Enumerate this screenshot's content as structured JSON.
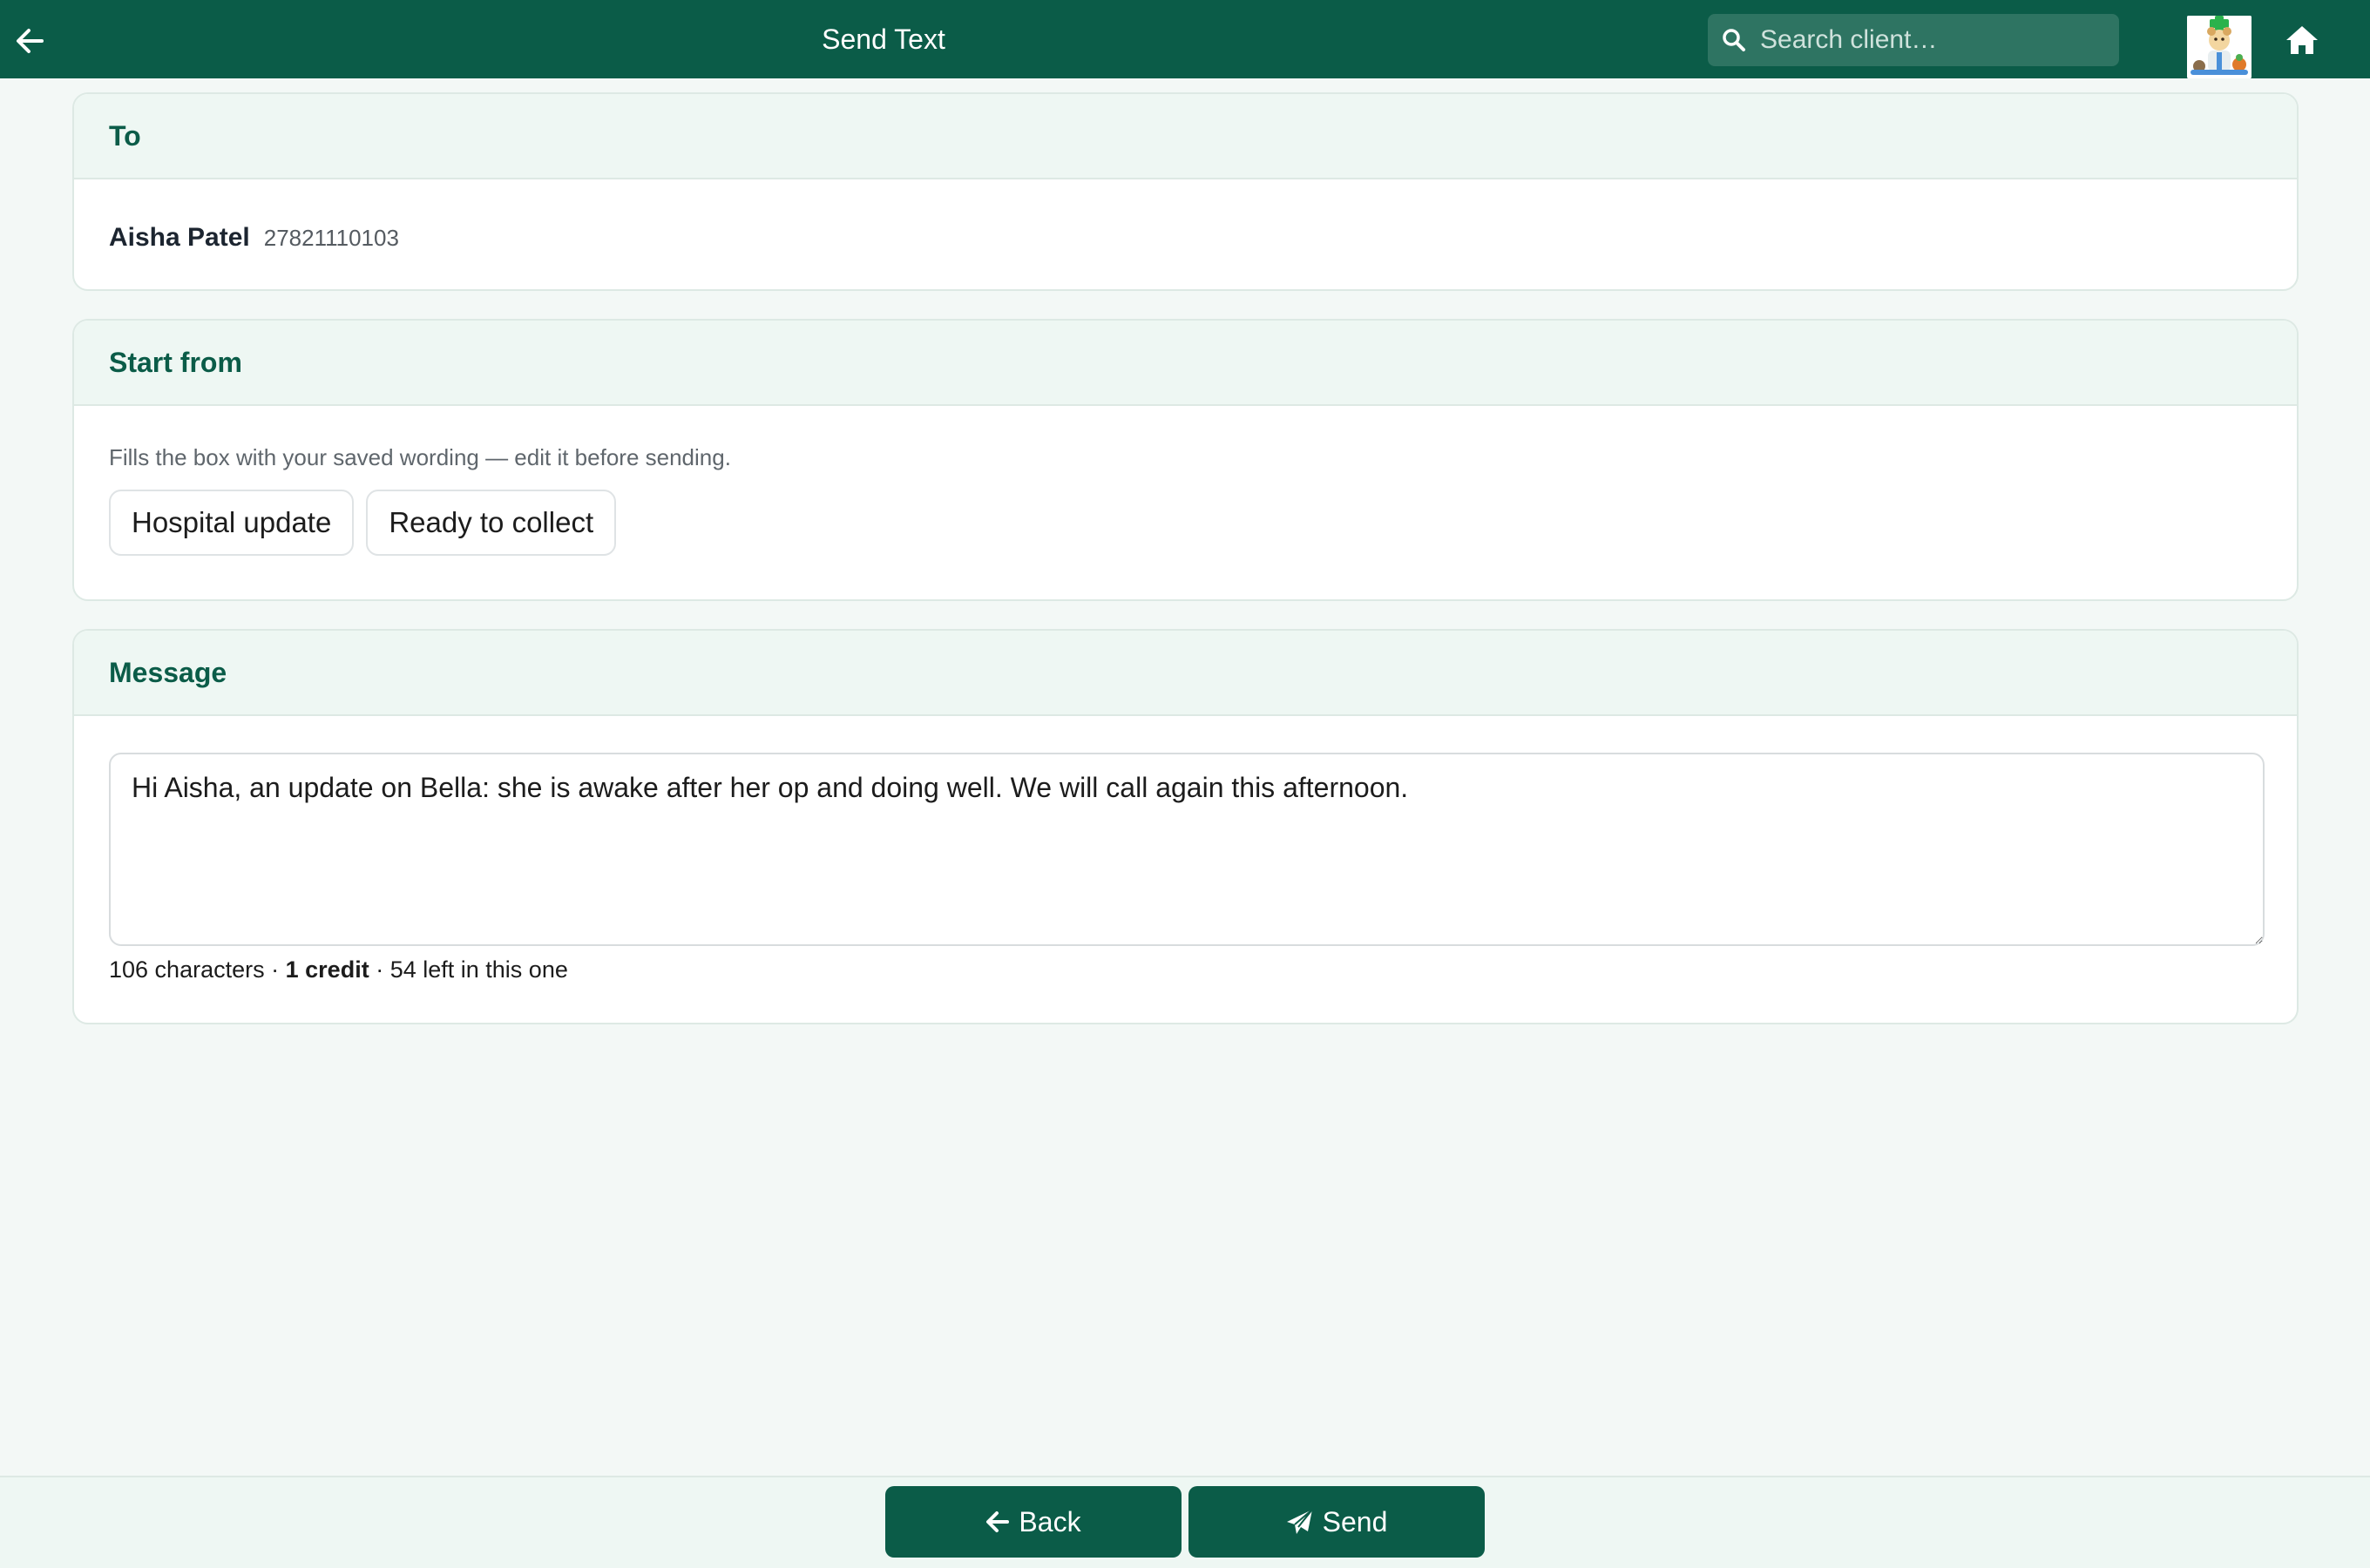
{
  "header": {
    "title": "Send Text",
    "search_placeholder": "Search client…",
    "back_icon": "arrow-left-icon",
    "home_icon": "home-icon",
    "search_icon": "search-icon"
  },
  "to_card": {
    "title": "To",
    "recipient_name": "Aisha Patel",
    "recipient_phone": "27821110103"
  },
  "start_card": {
    "title": "Start from",
    "hint": "Fills the box with your saved wording — edit it before sending.",
    "templates": [
      {
        "label": "Hospital update"
      },
      {
        "label": "Ready to collect"
      }
    ]
  },
  "message_card": {
    "title": "Message",
    "text": "Hi Aisha, an update on Bella: she is awake after her op and doing well. We will call again this afternoon.",
    "characters": "106 characters",
    "separator": "·",
    "credits": "1 credit",
    "remaining": "54 left in this one"
  },
  "footer": {
    "back_label": "Back",
    "send_label": "Send"
  },
  "colors": {
    "brand": "#0b5c48",
    "page_bg": "#f3f8f6",
    "card_header_bg": "#eef7f3"
  }
}
